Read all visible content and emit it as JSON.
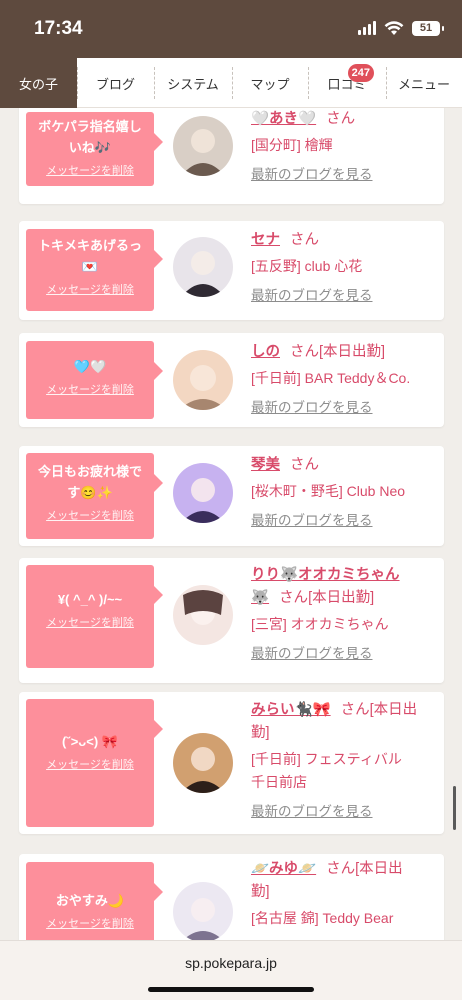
{
  "status": {
    "time": "17:34",
    "battery": "51"
  },
  "nav": {
    "tabs": [
      {
        "label": "女の子"
      },
      {
        "label": "ブログ"
      },
      {
        "label": "システム"
      },
      {
        "label": "マップ"
      },
      {
        "label": "口コミ",
        "badge": "247"
      },
      {
        "label": "メニュー"
      }
    ]
  },
  "delete_label": "メッセージを削除",
  "blog_label": "最新のブログを見る",
  "san_label": "さん",
  "cards": [
    {
      "message": "ボケパラ指名嬉し\nいね🎶",
      "name": "🤍あき🤍",
      "status": "",
      "shop": "[国分町] 檜輝",
      "avatar_colors": [
        "#d9cfc6",
        "#6b5a4f"
      ]
    },
    {
      "message": "トキメキあげるっ\n💌",
      "name": "セナ",
      "status": "",
      "shop": "[五反野] club 心花",
      "avatar_colors": [
        "#e8e4ea",
        "#2f2a33"
      ]
    },
    {
      "message": "🩵🤍",
      "name": "しの",
      "status": "[本日出勤]",
      "shop": "[千日前] BAR Teddy＆Co.",
      "avatar_colors": [
        "#f3d7c2",
        "#a7866f"
      ]
    },
    {
      "message": "今日もお疲れ様で\nす😊✨",
      "name": "琴美",
      "status": "",
      "shop": "[桜木町・野毛] Club Neo",
      "avatar_colors": [
        "#c7b2f0",
        "#3a2d5c"
      ]
    },
    {
      "message": "¥( ^_^ )/~~",
      "name": "りり🐺オオカミちゃん\n🐺",
      "status": "[本日出勤]",
      "shop": "[三宮] オオカミちゃん",
      "avatar_colors": [
        "#f4e6e2",
        "#5b4340"
      ]
    },
    {
      "message": "(˘>ᴗ<) 🎀",
      "name": "みらい🐈‍⬛🎀",
      "status": "[本日出\n勤]",
      "shop": "[千日前] フェスティバル\n千日前店",
      "avatar_colors": [
        "#d1a070",
        "#2c1f19"
      ]
    },
    {
      "message": "おやすみ🌙",
      "name": "🪐みゆ🪐",
      "status": "[本日出\n勤]",
      "shop": "[名古屋 錦] Teddy Bear",
      "avatar_colors": [
        "#ece8f2",
        "#7d7390"
      ]
    }
  ],
  "browser": {
    "url": "sp.pokepara.jp"
  }
}
